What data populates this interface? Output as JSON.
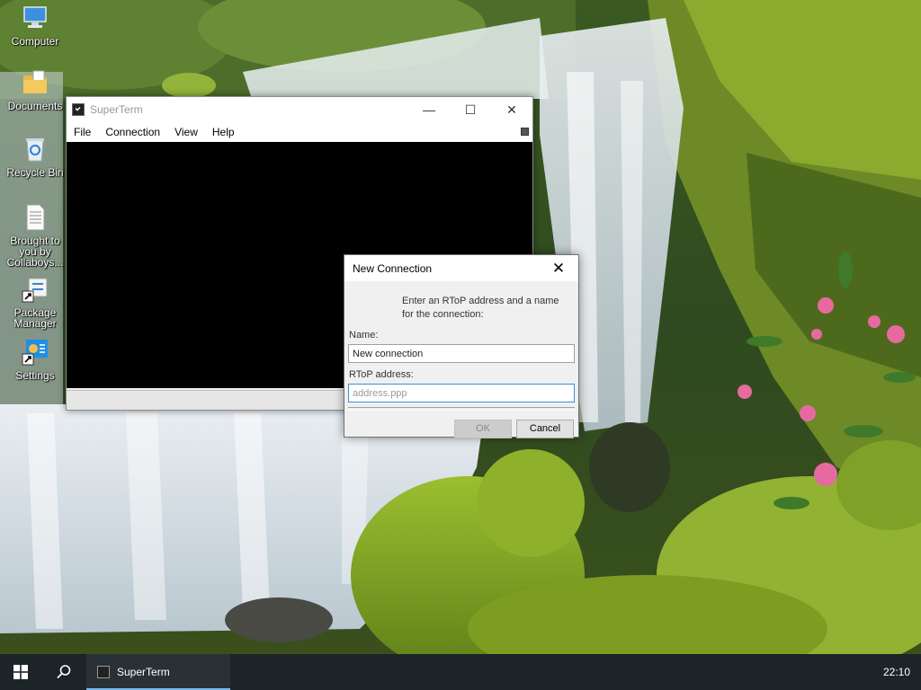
{
  "desktop": {
    "icons": [
      {
        "label": "Computer",
        "icon": "computer-icon"
      },
      {
        "label": "Documents",
        "icon": "documents-folder-icon"
      },
      {
        "label": "Recycle Bin",
        "icon": "recycle-bin-icon"
      },
      {
        "label": "Brought to you by Collaboys...",
        "icon": "text-file-icon"
      },
      {
        "label": "Package Manager",
        "icon": "package-manager-icon"
      },
      {
        "label": "Settings",
        "icon": "settings-icon"
      }
    ]
  },
  "superterm": {
    "title": "SuperTerm",
    "menu": [
      "File",
      "Connection",
      "View",
      "Help"
    ],
    "controls": {
      "minimize": "—",
      "maximize": "☐",
      "close": "✕"
    }
  },
  "dialog": {
    "title": "New Connection",
    "close": "✕",
    "intro": "Enter an RToP address and a name for the connection:",
    "name_label": "Name:",
    "name_value": "New connection",
    "address_label": "RToP address:",
    "address_placeholder": "address.ppp",
    "ok_label": "OK",
    "cancel_label": "Cancel"
  },
  "taskbar": {
    "task_label": "SuperTerm",
    "clock": "22:10"
  },
  "colors": {
    "accent": "#76b9ed",
    "taskbar": "#1d2428",
    "terminal_bg": "#000000"
  }
}
